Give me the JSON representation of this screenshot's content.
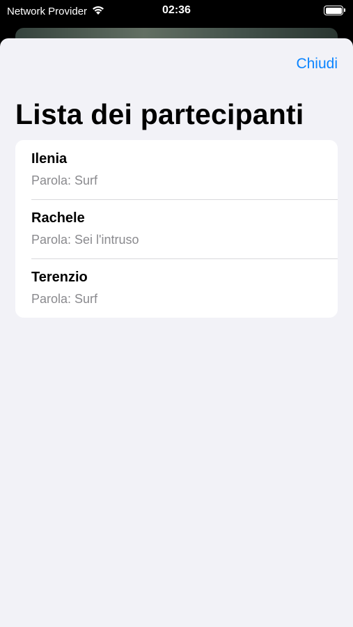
{
  "status_bar": {
    "carrier": "Network Provider",
    "time": "02:36"
  },
  "header": {
    "close_label": "Chiudi",
    "title": "Lista dei partecipanti"
  },
  "participants": [
    {
      "name": "Ilenia",
      "word": "Parola: Surf"
    },
    {
      "name": "Rachele",
      "word": "Parola: Sei l'intruso"
    },
    {
      "name": "Terenzio",
      "word": "Parola: Surf"
    }
  ],
  "colors": {
    "accent": "#0a84ff",
    "sheet_background": "#f2f2f7",
    "secondary_text": "#8a8a8e"
  }
}
